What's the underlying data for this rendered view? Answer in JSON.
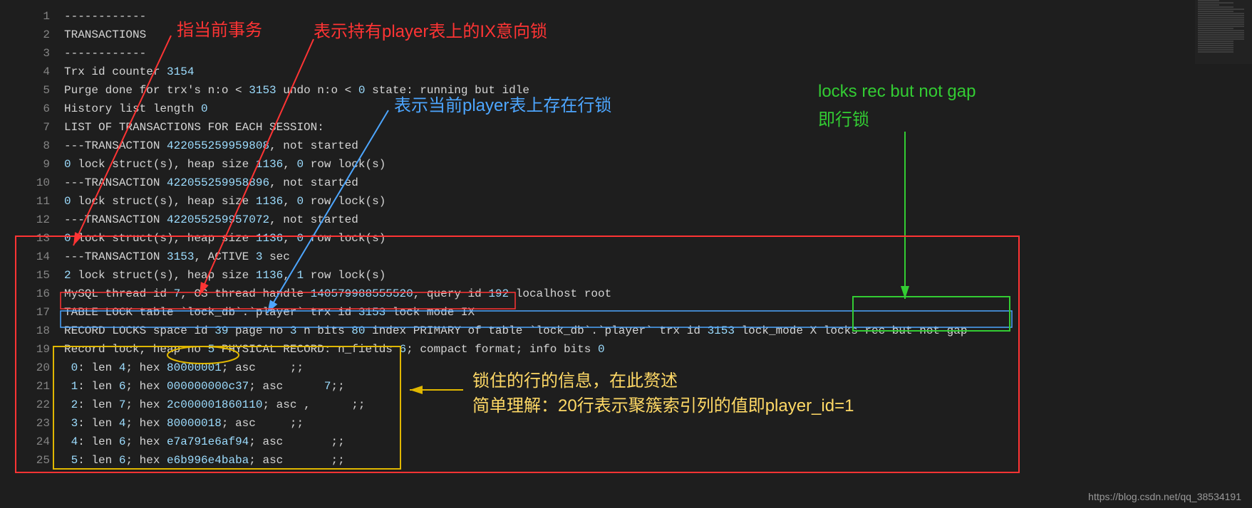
{
  "lines": [
    {
      "n": 1,
      "segments": [
        {
          "t": "------------"
        }
      ]
    },
    {
      "n": 2,
      "segments": [
        {
          "t": "TRANSACTIONS"
        }
      ]
    },
    {
      "n": 3,
      "segments": [
        {
          "t": "------------"
        }
      ]
    },
    {
      "n": 4,
      "segments": [
        {
          "t": "Trx id counter "
        },
        {
          "t": "3154",
          "c": "num"
        }
      ]
    },
    {
      "n": 5,
      "segments": [
        {
          "t": "Purge done for trx's n:o < "
        },
        {
          "t": "3153",
          "c": "num"
        },
        {
          "t": " undo n:o < "
        },
        {
          "t": "0",
          "c": "num"
        },
        {
          "t": " state: running but idle"
        }
      ]
    },
    {
      "n": 6,
      "segments": [
        {
          "t": "History list length "
        },
        {
          "t": "0",
          "c": "num"
        }
      ]
    },
    {
      "n": 7,
      "segments": [
        {
          "t": "LIST OF TRANSACTIONS FOR EACH SESSION:"
        }
      ]
    },
    {
      "n": 8,
      "segments": [
        {
          "t": "---TRANSACTION "
        },
        {
          "t": "422055259959808",
          "c": "num"
        },
        {
          "t": ", not started"
        }
      ]
    },
    {
      "n": 9,
      "segments": [
        {
          "t": "0",
          "c": "num"
        },
        {
          "t": " lock struct(s), heap size "
        },
        {
          "t": "1136",
          "c": "num"
        },
        {
          "t": ", "
        },
        {
          "t": "0",
          "c": "num"
        },
        {
          "t": " row lock(s)"
        }
      ]
    },
    {
      "n": 10,
      "segments": [
        {
          "t": "---TRANSACTION "
        },
        {
          "t": "422055259958896",
          "c": "num"
        },
        {
          "t": ", not started"
        }
      ]
    },
    {
      "n": 11,
      "segments": [
        {
          "t": "0",
          "c": "num"
        },
        {
          "t": " lock struct(s), heap size "
        },
        {
          "t": "1136",
          "c": "num"
        },
        {
          "t": ", "
        },
        {
          "t": "0",
          "c": "num"
        },
        {
          "t": " row lock(s)"
        }
      ]
    },
    {
      "n": 12,
      "segments": [
        {
          "t": "---TRANSACTION "
        },
        {
          "t": "422055259957072",
          "c": "num"
        },
        {
          "t": ", not started"
        }
      ]
    },
    {
      "n": 13,
      "segments": [
        {
          "t": "0",
          "c": "num"
        },
        {
          "t": " lock struct(s), heap size "
        },
        {
          "t": "1136",
          "c": "num"
        },
        {
          "t": ", "
        },
        {
          "t": "0",
          "c": "num"
        },
        {
          "t": " row lock(s)"
        }
      ]
    },
    {
      "n": 14,
      "segments": [
        {
          "t": "---TRANSACTION "
        },
        {
          "t": "3153",
          "c": "num"
        },
        {
          "t": ", ACTIVE "
        },
        {
          "t": "3",
          "c": "num"
        },
        {
          "t": " sec"
        }
      ]
    },
    {
      "n": 15,
      "segments": [
        {
          "t": "2",
          "c": "num"
        },
        {
          "t": " lock struct(s), heap size "
        },
        {
          "t": "1136",
          "c": "num"
        },
        {
          "t": ", "
        },
        {
          "t": "1",
          "c": "num"
        },
        {
          "t": " row lock(s)"
        }
      ]
    },
    {
      "n": 16,
      "segments": [
        {
          "t": "MySQL thread id "
        },
        {
          "t": "7",
          "c": "num"
        },
        {
          "t": ", OS thread handle "
        },
        {
          "t": "140579988555520",
          "c": "num"
        },
        {
          "t": ", query id "
        },
        {
          "t": "192",
          "c": "num"
        },
        {
          "t": " localhost root"
        }
      ]
    },
    {
      "n": 17,
      "segments": [
        {
          "t": "TABLE LOCK table `lock_db`.`player` trx id "
        },
        {
          "t": "3153",
          "c": "num"
        },
        {
          "t": " lock mode IX"
        }
      ]
    },
    {
      "n": 18,
      "segments": [
        {
          "t": "RECORD LOCKS space id "
        },
        {
          "t": "39",
          "c": "num"
        },
        {
          "t": " page no "
        },
        {
          "t": "3",
          "c": "num"
        },
        {
          "t": " n bits "
        },
        {
          "t": "80",
          "c": "num"
        },
        {
          "t": " index PRIMARY of table `lock_db`.`player` trx id "
        },
        {
          "t": "3153",
          "c": "num"
        },
        {
          "t": " lock_mode X locks rec but not gap"
        }
      ]
    },
    {
      "n": 19,
      "segments": [
        {
          "t": "Record lock, heap no "
        },
        {
          "t": "5",
          "c": "num"
        },
        {
          "t": " PHYSICAL RECORD: n_fields "
        },
        {
          "t": "6",
          "c": "num"
        },
        {
          "t": "; compact format; info bits "
        },
        {
          "t": "0",
          "c": "num"
        }
      ]
    },
    {
      "n": 20,
      "segments": [
        {
          "t": " "
        },
        {
          "t": "0",
          "c": "num"
        },
        {
          "t": ": len "
        },
        {
          "t": "4",
          "c": "num"
        },
        {
          "t": "; hex "
        },
        {
          "t": "80000001",
          "c": "num"
        },
        {
          "t": "; asc     ;;"
        }
      ]
    },
    {
      "n": 21,
      "segments": [
        {
          "t": " "
        },
        {
          "t": "1",
          "c": "num"
        },
        {
          "t": ": len "
        },
        {
          "t": "6",
          "c": "num"
        },
        {
          "t": "; hex "
        },
        {
          "t": "000000000c37",
          "c": "num"
        },
        {
          "t": "; asc      "
        },
        {
          "t": "7",
          "c": "num"
        },
        {
          "t": ";;"
        }
      ]
    },
    {
      "n": 22,
      "segments": [
        {
          "t": " "
        },
        {
          "t": "2",
          "c": "num"
        },
        {
          "t": ": len "
        },
        {
          "t": "7",
          "c": "num"
        },
        {
          "t": "; hex "
        },
        {
          "t": "2c000001860110",
          "c": "num"
        },
        {
          "t": "; asc ,      ;;"
        }
      ]
    },
    {
      "n": 23,
      "segments": [
        {
          "t": " "
        },
        {
          "t": "3",
          "c": "num"
        },
        {
          "t": ": len "
        },
        {
          "t": "4",
          "c": "num"
        },
        {
          "t": "; hex "
        },
        {
          "t": "80000018",
          "c": "num"
        },
        {
          "t": "; asc     ;;"
        }
      ]
    },
    {
      "n": 24,
      "segments": [
        {
          "t": " "
        },
        {
          "t": "4",
          "c": "num"
        },
        {
          "t": ": len "
        },
        {
          "t": "6",
          "c": "num"
        },
        {
          "t": "; hex "
        },
        {
          "t": "e7a791e6af94",
          "c": "num"
        },
        {
          "t": "; asc       ;;"
        }
      ]
    },
    {
      "n": 25,
      "segments": [
        {
          "t": " "
        },
        {
          "t": "5",
          "c": "num"
        },
        {
          "t": ": len "
        },
        {
          "t": "6",
          "c": "num"
        },
        {
          "t": "; hex "
        },
        {
          "t": "e6b996e4baba",
          "c": "num"
        },
        {
          "t": "; asc       ;;"
        }
      ]
    }
  ],
  "annotations": {
    "a1": "指当前事务",
    "a2": "表示持有player表上的IX意向锁",
    "a3": "表示当前player表上存在行锁",
    "a4_line1": "locks rec but not gap",
    "a4_line2": "即行锁",
    "a5_line1": "锁住的行的信息，在此赘述",
    "a5_line2": "简单理解：20行表示聚簇索引列的值即player_id=1"
  },
  "watermark": "https://blog.csdn.net/qq_38534191"
}
